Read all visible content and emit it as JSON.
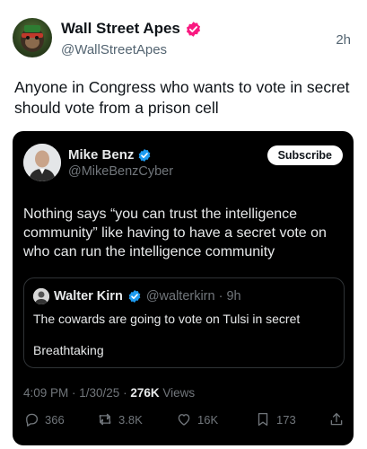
{
  "post": {
    "author_name": "Wall Street Apes",
    "author_handle": "@WallStreetApes",
    "time_ago": "2h",
    "text": "Anyone in Congress who wants to vote in secret should vote from a prison cell"
  },
  "embedded_post": {
    "author_name": "Mike Benz",
    "author_handle": "@MikeBenzCyber",
    "subscribe_label": "Subscribe",
    "text": "Nothing says “you can trust the intelligence community” like having to have a secret vote on who can run the intelligence community",
    "quoted_post": {
      "author_name": "Walter Kirn",
      "author_handle_time": "@walterkirn · 9h",
      "line1": "The cowards are going to vote on Tulsi in secret",
      "line2": "Breathtaking"
    },
    "timestamp": "4:09 PM · 1/30/25 · ",
    "views_count": "276K",
    "views_label": " Views",
    "actions": {
      "replies": "366",
      "reposts": "3.8K",
      "likes": "16K",
      "bookmarks": "173"
    }
  },
  "colors": {
    "verified_badge_outer": "#f91880",
    "verified_badge_inner": "#1d9bf0",
    "card_background": "#000000"
  },
  "icons": [
    "verified-icon",
    "reply-icon",
    "repost-icon",
    "like-icon",
    "bookmark-icon",
    "share-icon"
  ]
}
